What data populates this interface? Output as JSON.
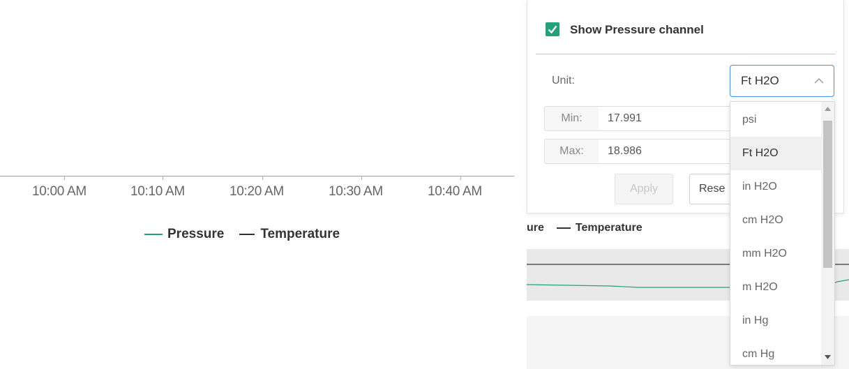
{
  "axis": {
    "ticks": [
      "10:00 AM",
      "10:10 AM",
      "10:20 AM",
      "10:30 AM",
      "10:40 AM"
    ]
  },
  "legend": {
    "pressure_label": "Pressure",
    "temperature_label": "Temperature",
    "pressure_color": "#23a17a",
    "temperature_color": "#333333"
  },
  "legend_clipped": {
    "pressure_label": "ure",
    "temperature_label": "Temperature"
  },
  "popover": {
    "show_channel_label": "Show Pressure channel",
    "show_channel_checked": true,
    "unit_label": "Unit:",
    "unit_value": "Ft H2O",
    "min_label": "Min:",
    "min_value": "17.991",
    "max_label": "Max:",
    "max_value": "18.986",
    "apply_label": "Apply",
    "reset_label": "Rese",
    "accent_color": "#23a17a"
  },
  "dropdown": {
    "options": [
      "psi",
      "Ft H2O",
      "in H2O",
      "cm H2O",
      "mm H2O",
      "m H2O",
      "in Hg",
      "cm Hg"
    ],
    "selected": "Ft H2O"
  }
}
